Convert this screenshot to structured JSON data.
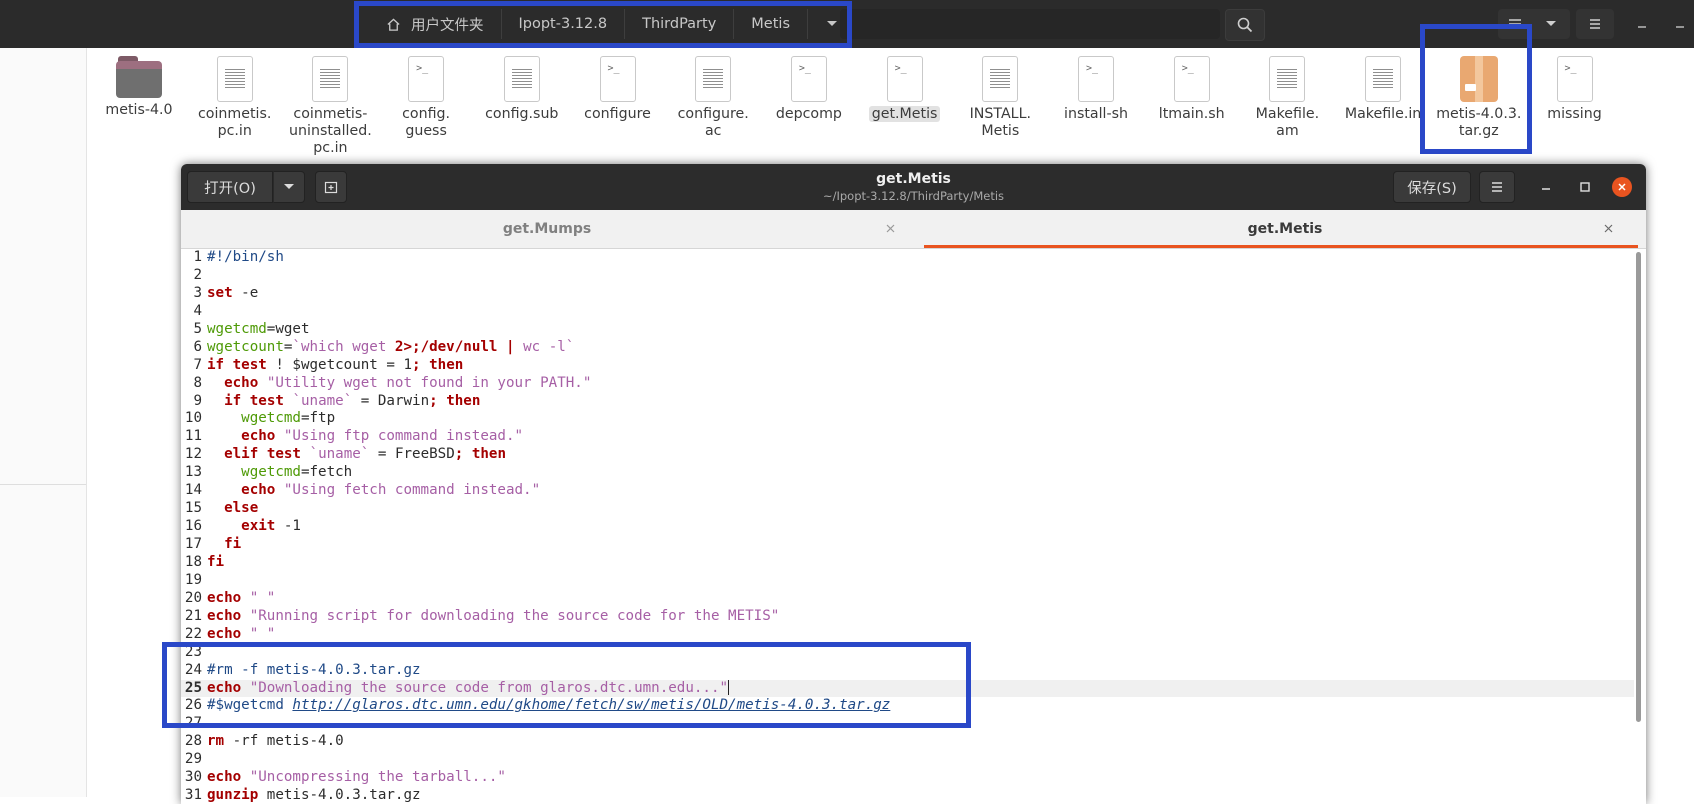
{
  "file_manager": {
    "breadcrumbs": [
      "用户文件夹",
      "Ipopt-3.12.8",
      "ThirdParty",
      "Metis"
    ],
    "files": [
      {
        "name": "metis-4.0",
        "type": "folder"
      },
      {
        "name": "coinmetis.pc.in",
        "type": "text"
      },
      {
        "name": "coinmetis-uninstalled.pc.in",
        "type": "text"
      },
      {
        "name": "config.guess",
        "type": "script"
      },
      {
        "name": "config.sub",
        "type": "text"
      },
      {
        "name": "configure",
        "type": "script"
      },
      {
        "name": "configure.ac",
        "type": "text"
      },
      {
        "name": "depcomp",
        "type": "script"
      },
      {
        "name": "get.Metis",
        "type": "script",
        "selected": true
      },
      {
        "name": "INSTALL.Metis",
        "type": "text"
      },
      {
        "name": "install-sh",
        "type": "script"
      },
      {
        "name": "ltmain.sh",
        "type": "script"
      },
      {
        "name": "Makefile.am",
        "type": "text"
      },
      {
        "name": "Makefile.in",
        "type": "text"
      },
      {
        "name": "metis-4.0.3.tar.gz",
        "type": "archive"
      },
      {
        "name": "missing",
        "type": "script"
      }
    ],
    "file_labels": [
      [
        "metis-4.0"
      ],
      [
        "coinmetis.",
        "pc.in"
      ],
      [
        "coinmetis-",
        "uninstalled.",
        "pc.in"
      ],
      [
        "config.",
        "guess"
      ],
      [
        "config.sub"
      ],
      [
        "configure"
      ],
      [
        "configure.",
        "ac"
      ],
      [
        "depcomp"
      ],
      [
        "get.Metis"
      ],
      [
        "INSTALL.",
        "Metis"
      ],
      [
        "install-sh"
      ],
      [
        "ltmain.sh"
      ],
      [
        "Makefile.",
        "am"
      ],
      [
        "Makefile.in"
      ],
      [
        "metis-4.0.3.",
        "tar.gz"
      ],
      [
        "missing"
      ]
    ]
  },
  "editor": {
    "open_label": "打开(O)",
    "save_label": "保存(S)",
    "title": "get.Metis",
    "subtitle": "~/Ipopt-3.12.8/ThirdParty/Metis",
    "tabs": [
      {
        "label": "get.Mumps",
        "active": false
      },
      {
        "label": "get.Metis",
        "active": true
      }
    ],
    "current_line": 25,
    "lines": [
      "#!/bin/sh",
      "",
      "set -e",
      "",
      "wgetcmd=wget",
      "wgetcount=`which wget 2>/dev/null | wc -l`",
      "if test ! $wgetcount = 1; then",
      "  echo \"Utility wget not found in your PATH.\"",
      "  if test `uname` = Darwin; then",
      "    wgetcmd=ftp",
      "    echo \"Using ftp command instead.\"",
      "  elif test `uname` = FreeBSD; then",
      "    wgetcmd=fetch",
      "    echo \"Using fetch command instead.\"",
      "  else",
      "    exit -1",
      "  fi",
      "fi",
      "",
      "echo \" \"",
      "echo \"Running script for downloading the source code for the METIS\"",
      "echo \" \"",
      "",
      "#rm -f metis-4.0.3.tar.gz",
      "echo \"Downloading the source code from glaros.dtc.umn.edu...\"",
      "#$wgetcmd http://glaros.dtc.umn.edu/gkhome/fetch/sw/metis/OLD/metis-4.0.3.tar.gz",
      "",
      "rm -rf metis-4.0",
      "",
      "echo \"Uncompressing the tarball...\"",
      "gunzip metis-4.0.3.tar.gz"
    ]
  },
  "colors": {
    "annotation_box": "#2a48c8",
    "accent": "#e95420",
    "keyword": "#a40000",
    "string": "#a65fa5",
    "variable": "#4e9a06",
    "comment": "#204a87"
  }
}
